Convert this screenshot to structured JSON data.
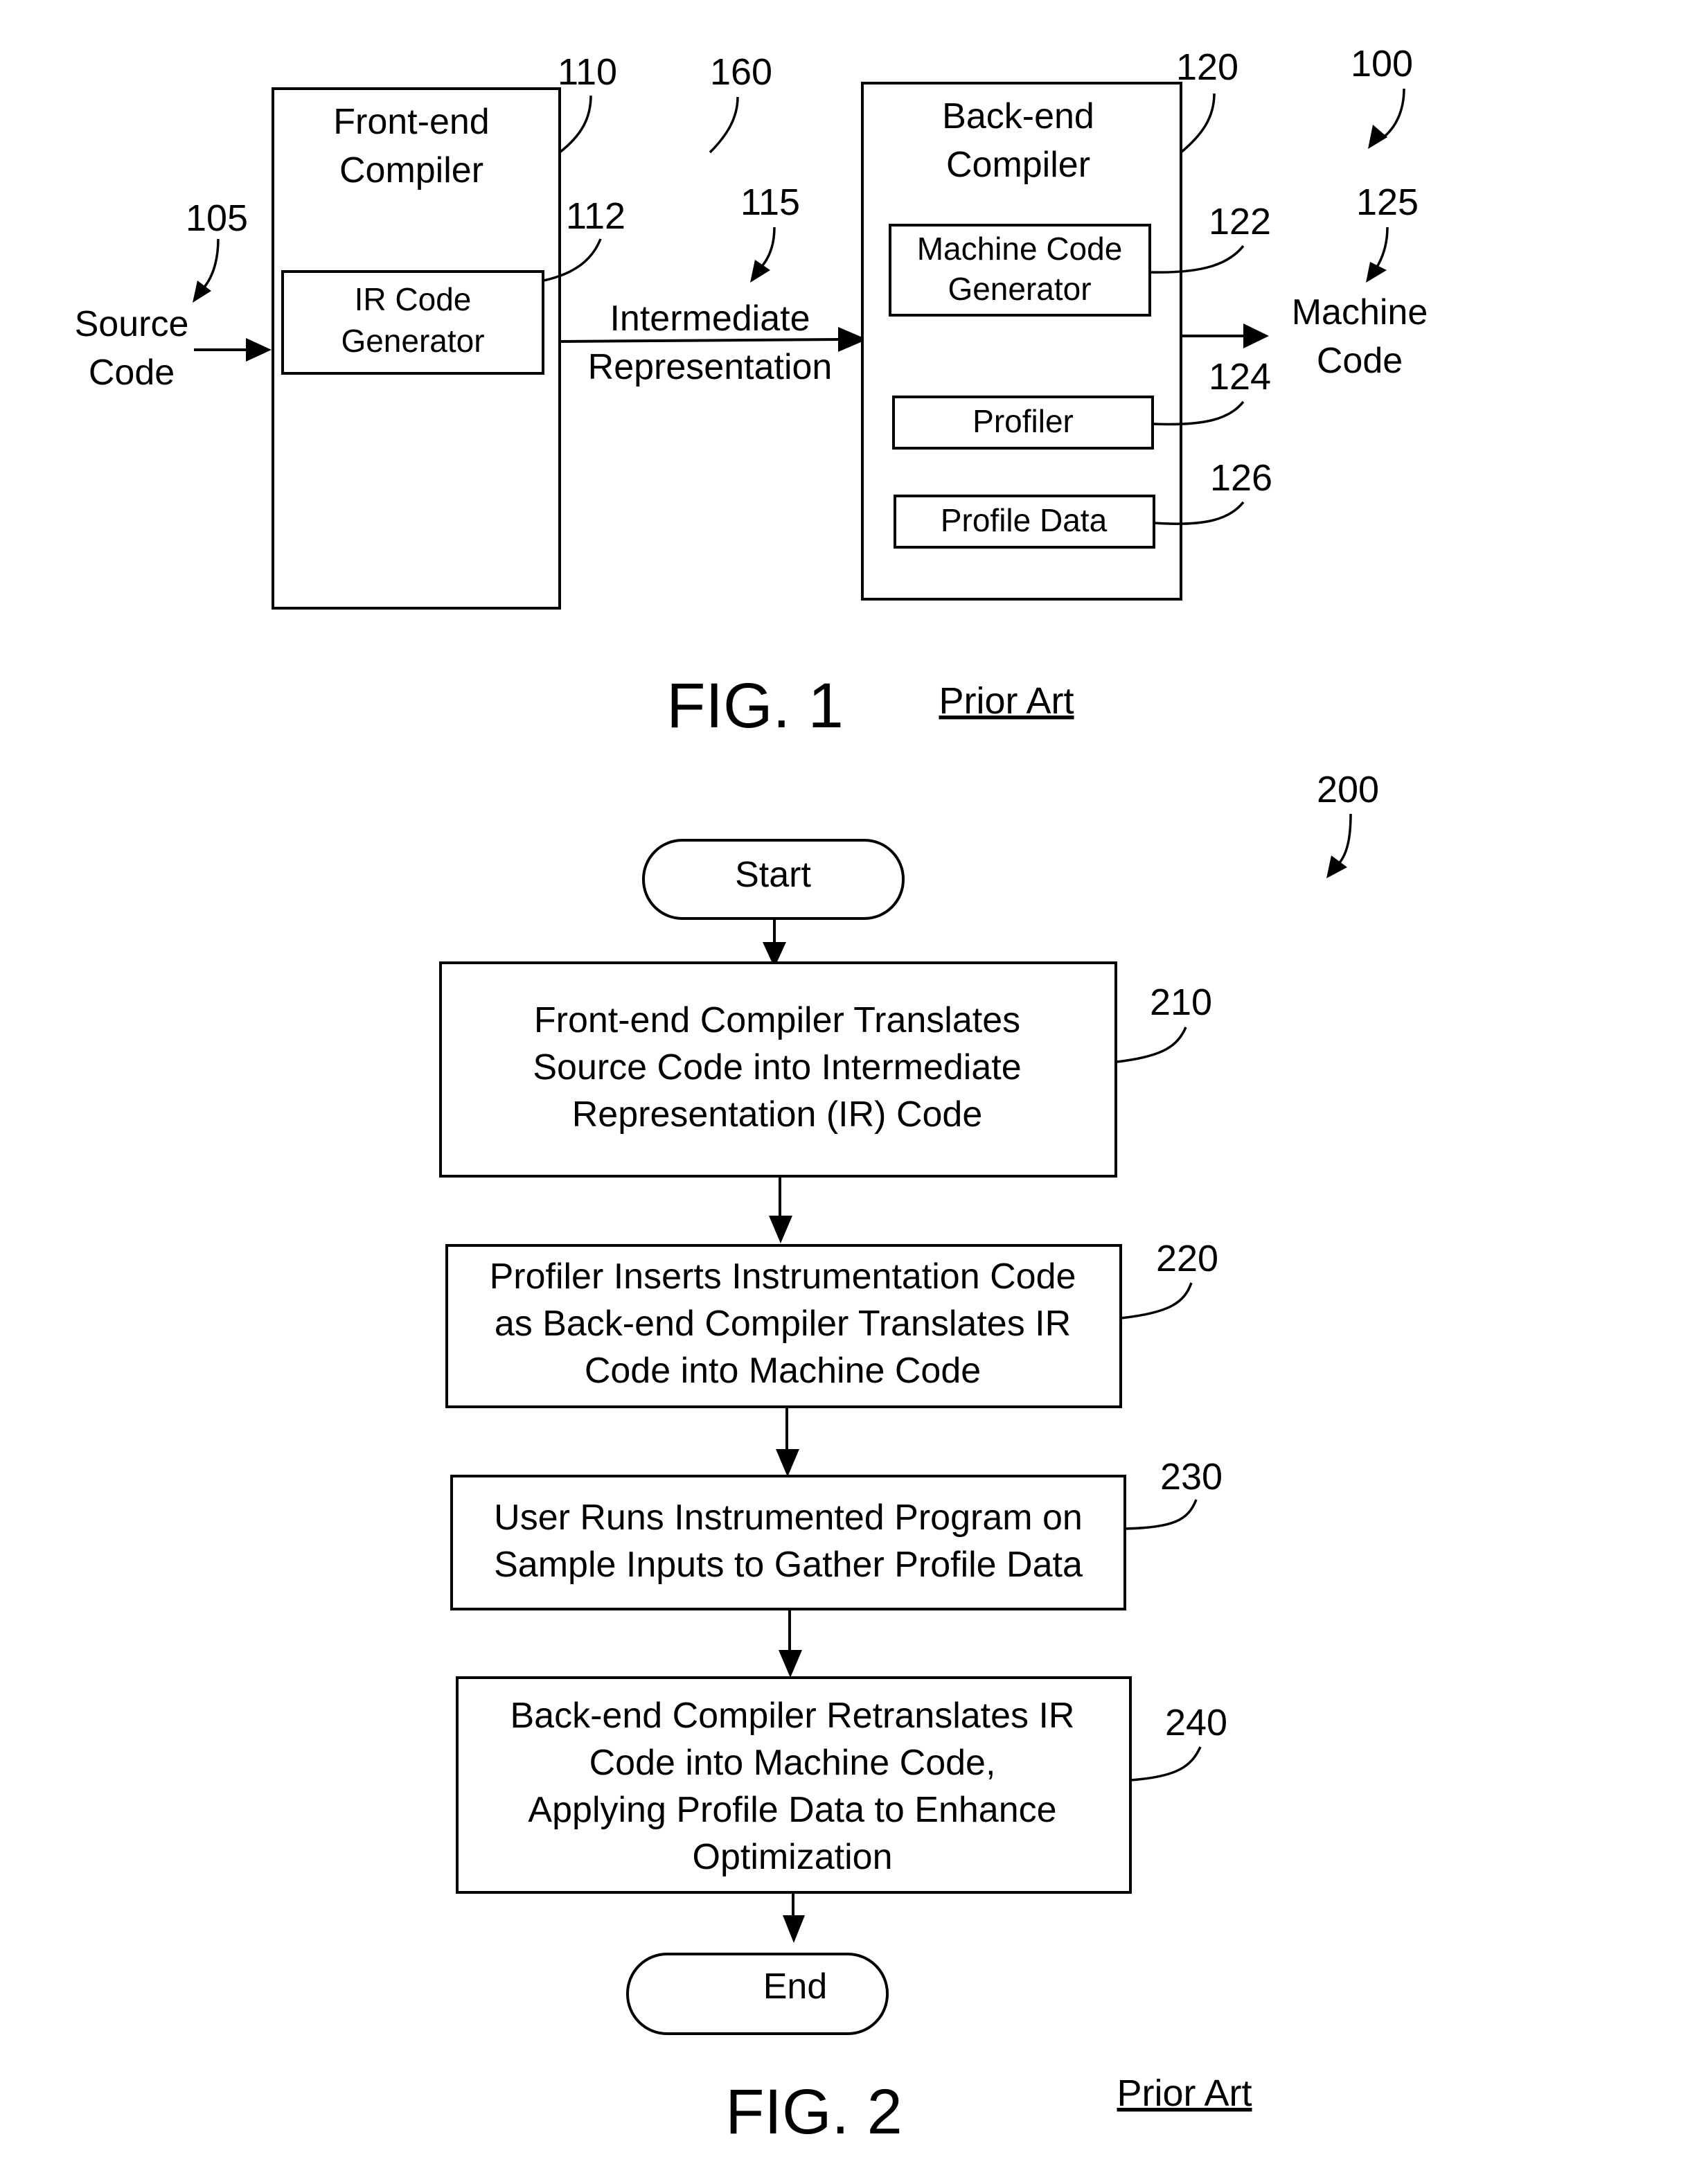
{
  "fig1": {
    "ref": "100",
    "caption": "FIG. 1",
    "note": "Prior Art",
    "source_code": {
      "ref": "105",
      "lines": [
        "Source",
        "Code"
      ]
    },
    "front_end": {
      "ref": "110",
      "lines": [
        "Front-end",
        "Compiler"
      ],
      "ir_generator": {
        "ref": "112",
        "lines": [
          "IR Code",
          "Generator"
        ]
      }
    },
    "intermediate": {
      "ref": "115",
      "lines": [
        "Intermediate",
        "Representation"
      ]
    },
    "region_ref": "160",
    "back_end": {
      "ref": "120",
      "lines": [
        "Back-end",
        "Compiler"
      ],
      "machine_code_generator": {
        "ref": "122",
        "lines": [
          "Machine Code",
          "Generator"
        ]
      },
      "profiler": {
        "ref": "124",
        "label": "Profiler"
      },
      "profile_data": {
        "ref": "126",
        "label": "Profile Data"
      }
    },
    "machine_code": {
      "ref": "125",
      "lines": [
        "Machine",
        "Code"
      ]
    }
  },
  "fig2": {
    "ref": "200",
    "caption": "FIG. 2",
    "note": "Prior Art",
    "start": "Start",
    "end": "End",
    "steps": [
      {
        "ref": "210",
        "lines": [
          "Front-end Compiler Translates",
          "Source Code into Intermediate",
          "Representation (IR) Code"
        ]
      },
      {
        "ref": "220",
        "lines": [
          "Profiler Inserts Instrumentation Code",
          "as Back-end Compiler Translates IR",
          "Code into Machine Code"
        ]
      },
      {
        "ref": "230",
        "lines": [
          "User Runs Instrumented Program on",
          "Sample Inputs to Gather Profile Data"
        ]
      },
      {
        "ref": "240",
        "lines": [
          "Back-end Compiler Retranslates IR",
          "Code into Machine Code,",
          "Applying Profile Data to Enhance",
          "Optimization"
        ]
      }
    ]
  }
}
